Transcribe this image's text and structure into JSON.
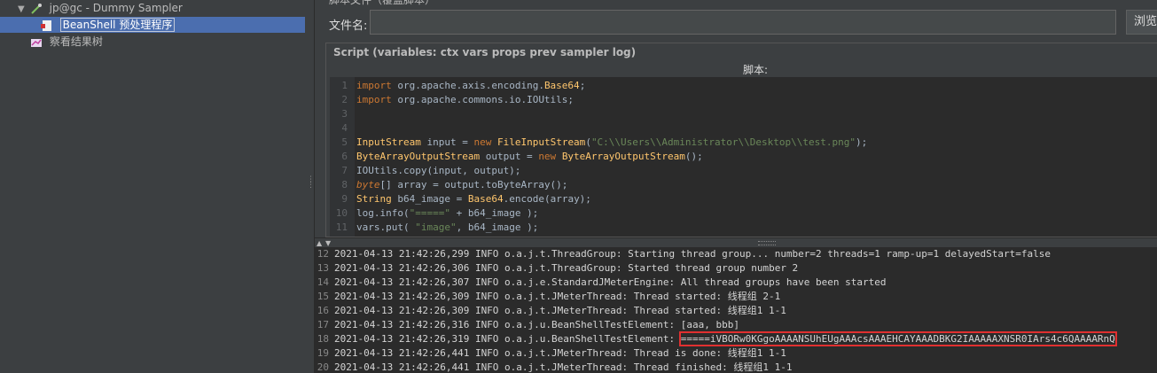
{
  "tree": {
    "items": [
      {
        "label": "jp@gc - Dummy Sampler",
        "icon": "pipette-icon",
        "indent": 1
      },
      {
        "label": "BeanShell 预处理程序",
        "icon": "beanshell-icon",
        "indent": 2,
        "selected": true
      },
      {
        "label": "察看结果树",
        "icon": "listener-icon",
        "indent": 1
      }
    ]
  },
  "script_file": {
    "section_label": "脚本文件（覆盖脚本）",
    "file_name_label": "文件名:",
    "file_name_value": "",
    "browse_label": "浏览"
  },
  "script": {
    "title": "Script (variables: ctx vars props prev sampler log)",
    "caption": "脚本:",
    "lines": [
      {
        "n": "1",
        "text": "import org.apache.axis.encoding.Base64;"
      },
      {
        "n": "2",
        "text": "import org.apache.commons.io.IOUtils;"
      },
      {
        "n": "3",
        "text": ""
      },
      {
        "n": "4",
        "text": ""
      },
      {
        "n": "5",
        "text": "InputStream input = new FileInputStream(\"C:\\\\Users\\\\Administrator\\\\Desktop\\\\test.png\");"
      },
      {
        "n": "6",
        "text": "ByteArrayOutputStream output = new ByteArrayOutputStream();"
      },
      {
        "n": "7",
        "text": "IOUtils.copy(input, output);"
      },
      {
        "n": "8",
        "text": "byte[] array = output.toByteArray();"
      },
      {
        "n": "9",
        "text": "String b64_image = Base64.encode(array);"
      },
      {
        "n": "10",
        "text": "log.info(\"=====\" + b64_image );"
      },
      {
        "n": "11",
        "text": "vars.put( \"image\", b64_image );"
      }
    ]
  },
  "log": {
    "lines": [
      {
        "n": "12",
        "text": "2021-04-13 21:42:26,299 INFO o.a.j.t.ThreadGroup: Starting thread group... number=2 threads=1 ramp-up=1 delayedStart=false"
      },
      {
        "n": "13",
        "text": "2021-04-13 21:42:26,306 INFO o.a.j.t.ThreadGroup: Started thread group number 2"
      },
      {
        "n": "14",
        "text": "2021-04-13 21:42:26,307 INFO o.a.j.e.StandardJMeterEngine: All thread groups have been started"
      },
      {
        "n": "15",
        "text": "2021-04-13 21:42:26,309 INFO o.a.j.t.JMeterThread: Thread started: 线程组 2-1"
      },
      {
        "n": "16",
        "text": "2021-04-13 21:42:26,309 INFO o.a.j.t.JMeterThread: Thread started: 线程组1 1-1"
      },
      {
        "n": "17",
        "text": "2021-04-13 21:42:26,316 INFO o.a.j.u.BeanShellTestElement: [aaa, bbb]"
      },
      {
        "n": "18",
        "text": "2021-04-13 21:42:26,319 INFO o.a.j.u.BeanShellTestElement: ",
        "highlight": "=====iVBORw0KGgoAAAANSUhEUgAAAcsAAAEHCAYAAADBKG2IAAAAAXNSR0IArs4c6QAAAARnQ"
      },
      {
        "n": "19",
        "text": "2021-04-13 21:42:26,441 INFO o.a.j.t.JMeterThread: Thread is done: 线程组1 1-1"
      },
      {
        "n": "20",
        "text": "2021-04-13 21:42:26,441 INFO o.a.j.t.JMeterThread: Thread finished: 线程组1 1-1"
      }
    ]
  }
}
